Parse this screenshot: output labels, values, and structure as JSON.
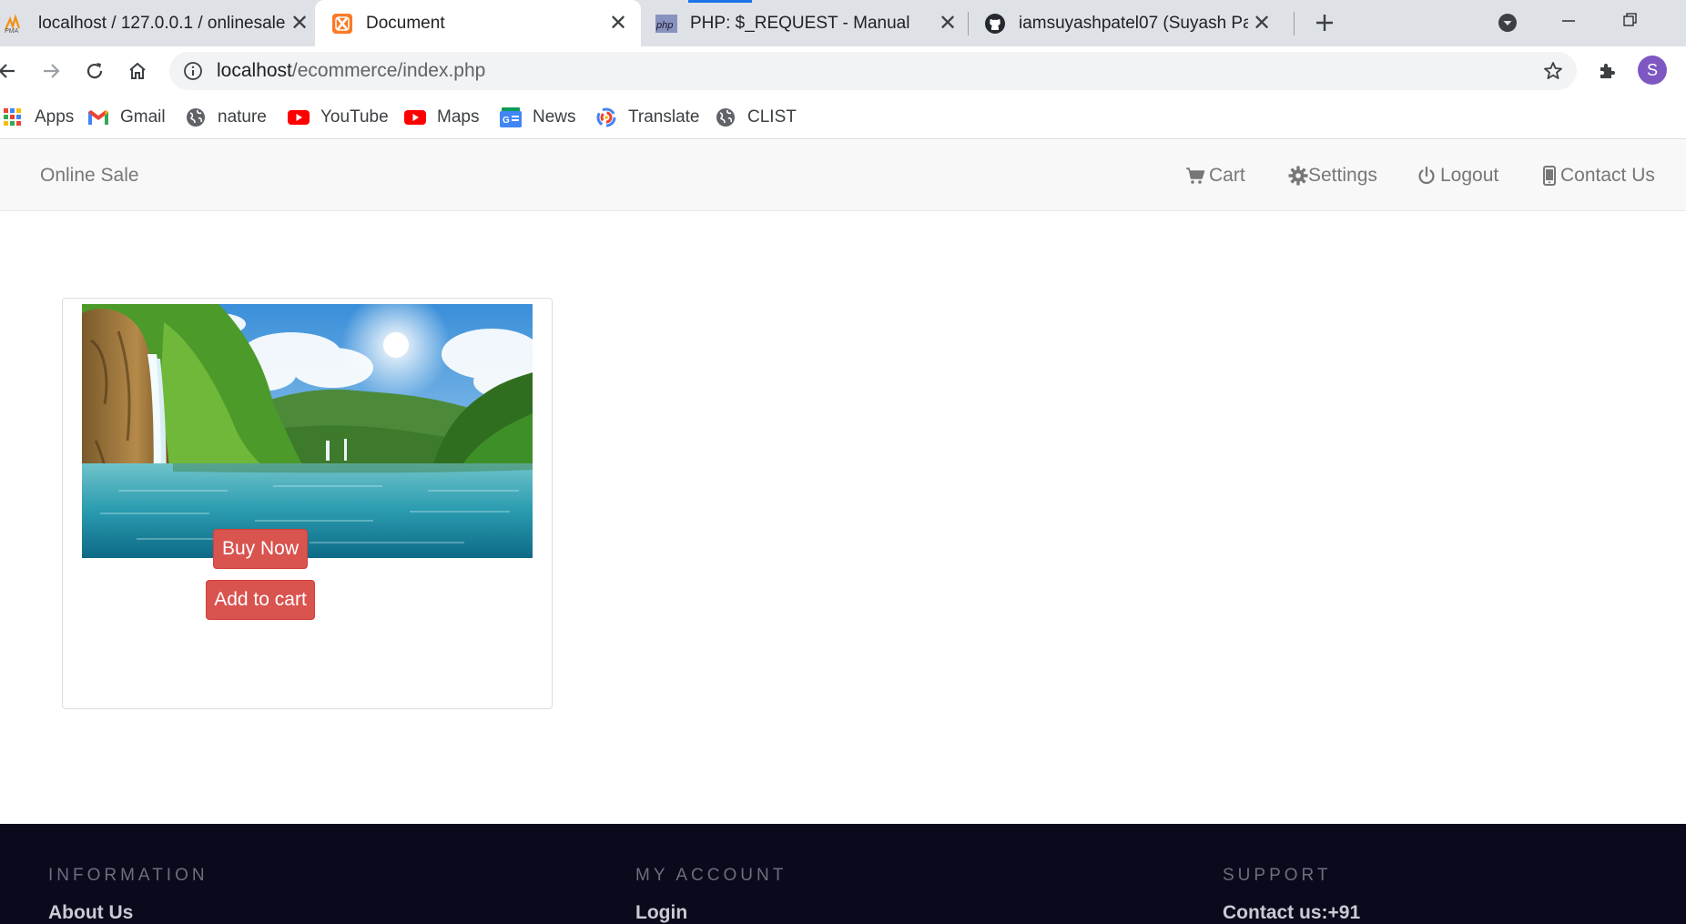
{
  "browser": {
    "tabs": [
      {
        "title": "localhost / 127.0.0.1 / onlinesale",
        "icon": "phpmyadmin-icon"
      },
      {
        "title": "Document",
        "icon": "xampp-icon"
      },
      {
        "title": "PHP: $_REQUEST - Manual",
        "icon": "php-icon"
      },
      {
        "title": "iamsuyashpatel07 (Suyash Patel)",
        "icon": "github-icon"
      }
    ],
    "url_host": "localhost",
    "url_path": "/ecommerce/index.php",
    "profile_initial": "S",
    "bookmarks": [
      {
        "label": "Apps",
        "icon": "apps-grid-icon"
      },
      {
        "label": "Gmail",
        "icon": "gmail-icon"
      },
      {
        "label": "nature",
        "icon": "globe-icon"
      },
      {
        "label": "YouTube",
        "icon": "youtube-icon"
      },
      {
        "label": "Maps",
        "icon": "youtube-icon"
      },
      {
        "label": "News",
        "icon": "google-news-icon"
      },
      {
        "label": "Translate",
        "icon": "translate-icon"
      },
      {
        "label": "CLIST",
        "icon": "globe-icon"
      }
    ]
  },
  "navbar": {
    "brand": "Online Sale",
    "items": [
      {
        "label": "Cart",
        "icon": "cart-icon"
      },
      {
        "label": "Settings",
        "icon": "gear-icon"
      },
      {
        "label": "Logout",
        "icon": "power-icon"
      },
      {
        "label": "Contact Us",
        "icon": "phone-icon"
      }
    ]
  },
  "product": {
    "image": "waterfall-lake-landscape",
    "buy_label": "Buy Now",
    "cart_label": "Add to cart"
  },
  "footer": {
    "columns": [
      {
        "heading": "INFORMATION",
        "link": "About Us"
      },
      {
        "heading": "MY ACCOUNT",
        "link": "Login"
      },
      {
        "heading": "SUPPORT",
        "link": "Contact us:+91"
      }
    ]
  },
  "colors": {
    "danger": "#d9534f",
    "footer_bg": "#0a0a1c",
    "navbar_bg": "#f8f8f8"
  }
}
